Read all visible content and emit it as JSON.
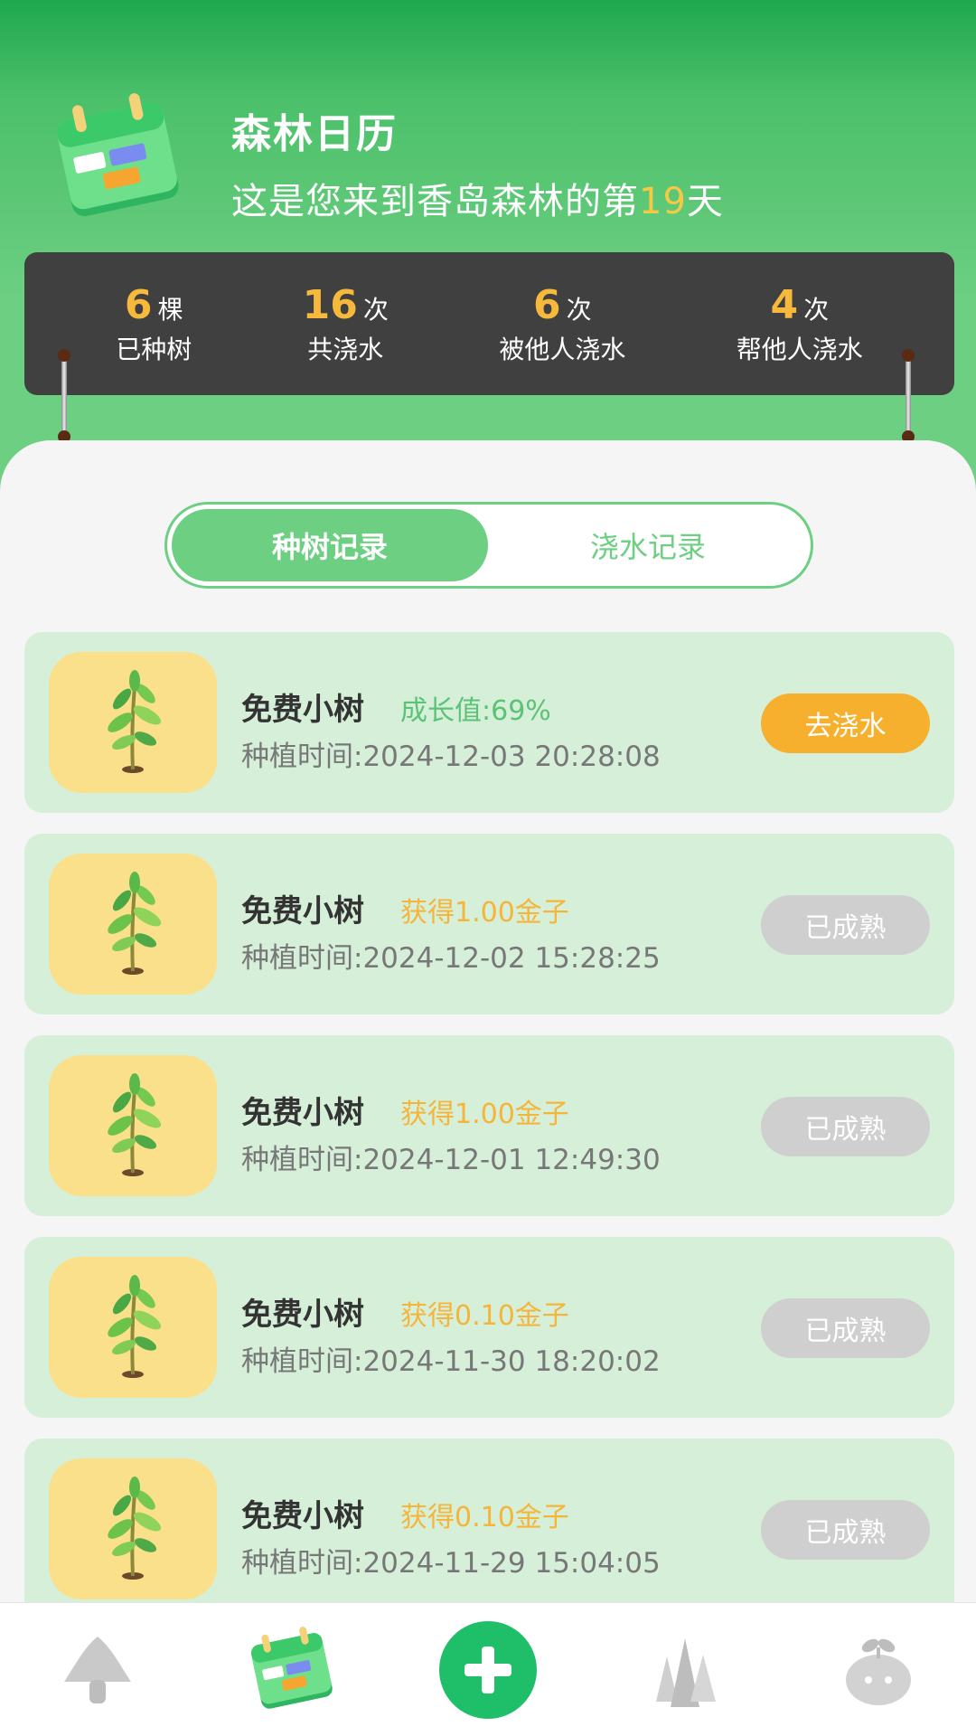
{
  "header": {
    "title": "森林日历",
    "subtitle_prefix": "这是您来到香岛森林的第",
    "subtitle_day": "19",
    "subtitle_suffix": "天",
    "icon": "calendar-icon"
  },
  "stats": [
    {
      "value": "6",
      "unit": "棵",
      "label": "已种树"
    },
    {
      "value": "16",
      "unit": "次",
      "label": "共浇水"
    },
    {
      "value": "6",
      "unit": "次",
      "label": "被他人浇水"
    },
    {
      "value": "4",
      "unit": "次",
      "label": "帮他人浇水"
    }
  ],
  "tabs": {
    "active": "种树记录",
    "inactive": "浇水记录"
  },
  "records": [
    {
      "name": "免费小树",
      "status": "成长值:69%",
      "status_type": "growth",
      "time": "种植时间:2024-12-03 20:28:08",
      "button": "去浇水",
      "button_type": "water"
    },
    {
      "name": "免费小树",
      "status": "获得1.00金子",
      "status_type": "reward",
      "time": "种植时间:2024-12-02 15:28:25",
      "button": "已成熟",
      "button_type": "done"
    },
    {
      "name": "免费小树",
      "status": "获得1.00金子",
      "status_type": "reward",
      "time": "种植时间:2024-12-01 12:49:30",
      "button": "已成熟",
      "button_type": "done"
    },
    {
      "name": "免费小树",
      "status": "获得0.10金子",
      "status_type": "reward",
      "time": "种植时间:2024-11-30 18:20:02",
      "button": "已成熟",
      "button_type": "done"
    },
    {
      "name": "免费小树",
      "status": "获得0.10金子",
      "status_type": "reward",
      "time": "种植时间:2024-11-29 15:04:05",
      "button": "已成熟",
      "button_type": "done"
    }
  ],
  "bottom_nav": [
    {
      "icon": "mushroom-icon"
    },
    {
      "icon": "calendar-icon"
    },
    {
      "icon": "plus-icon"
    },
    {
      "icon": "forest-icon"
    },
    {
      "icon": "sprout-icon"
    }
  ],
  "colors": {
    "primary_green": "#6ccf82",
    "dark_board": "#404040",
    "accent_orange": "#f6b02e",
    "card_bg": "#d6efd9",
    "thumb_bg": "#fae08a"
  }
}
